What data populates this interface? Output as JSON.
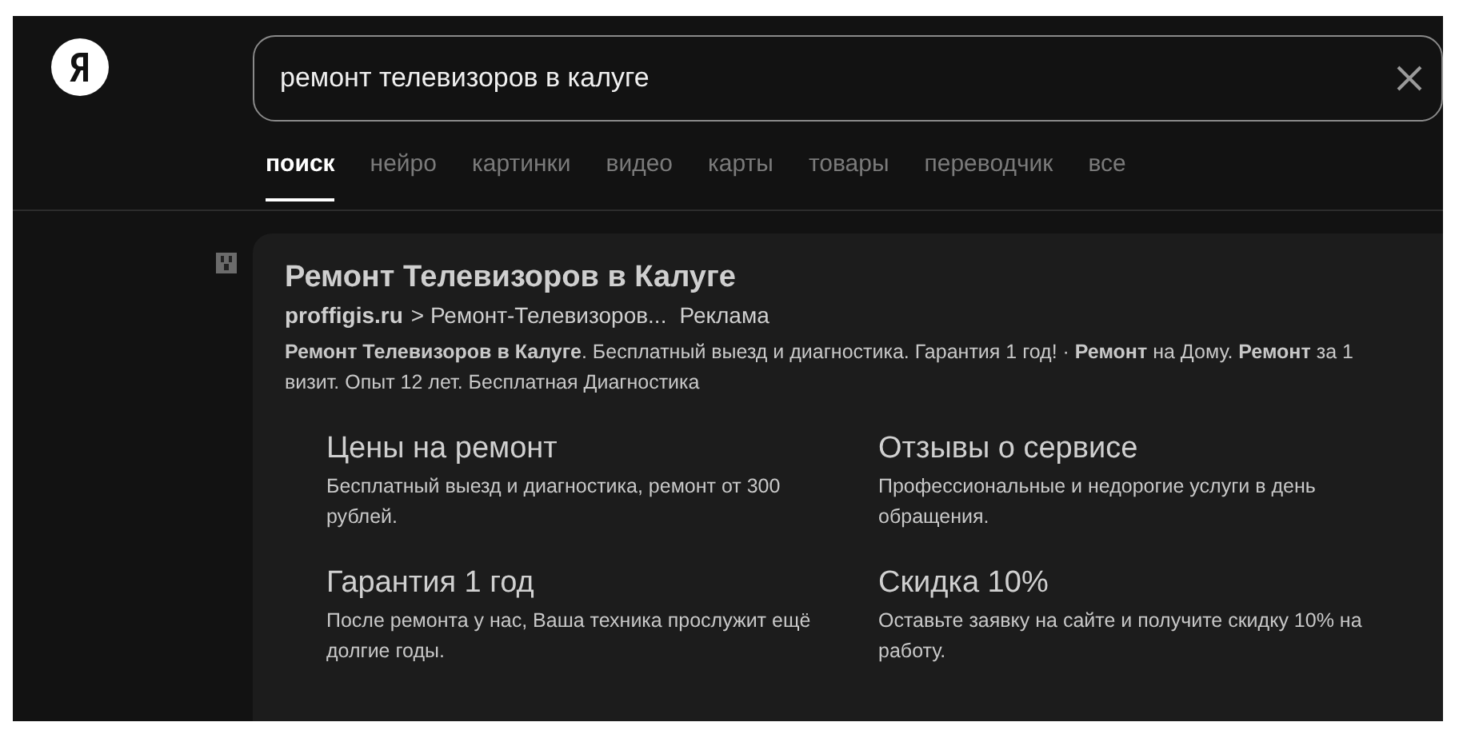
{
  "search": {
    "value": "ремонт телевизоров в калуге"
  },
  "tabs": [
    {
      "label": "поиск",
      "selected": true
    },
    {
      "label": "нейро",
      "selected": false
    },
    {
      "label": "картинки",
      "selected": false
    },
    {
      "label": "видео",
      "selected": false
    },
    {
      "label": "карты",
      "selected": false
    },
    {
      "label": "товары",
      "selected": false
    },
    {
      "label": "переводчик",
      "selected": false
    },
    {
      "label": "все",
      "selected": false
    }
  ],
  "result": {
    "title": "Ремонт Телевизоров в Калуге",
    "domain": "proffigis.ru",
    "path": "> Ремонт-Телевизоров...",
    "ad_label": "Реклама",
    "snippet": "**Ремонт Телевизоров в Калуге**. Бесплатный выезд и диагностика. Гарантия 1 год! · **Ремонт** на Дому. **Ремонт** за 1 визит. Опыт 12 лет. Бесплатная Диагностика",
    "sitelinks": [
      {
        "title": "Цены на ремонт",
        "text": "Бесплатный выезд и диагностика, ремонт от 300 рублей."
      },
      {
        "title": "Отзывы о сервисе",
        "text": "Профессиональные и недорогие услуги в день обращения."
      },
      {
        "title": "Гарантия 1 год",
        "text": "После ремонта у нас, Ваша техника прослужит ещё долгие годы."
      },
      {
        "title": "Скидка 10%",
        "text": "Оставьте заявку на сайте и получите скидку 10% на работу."
      }
    ]
  }
}
